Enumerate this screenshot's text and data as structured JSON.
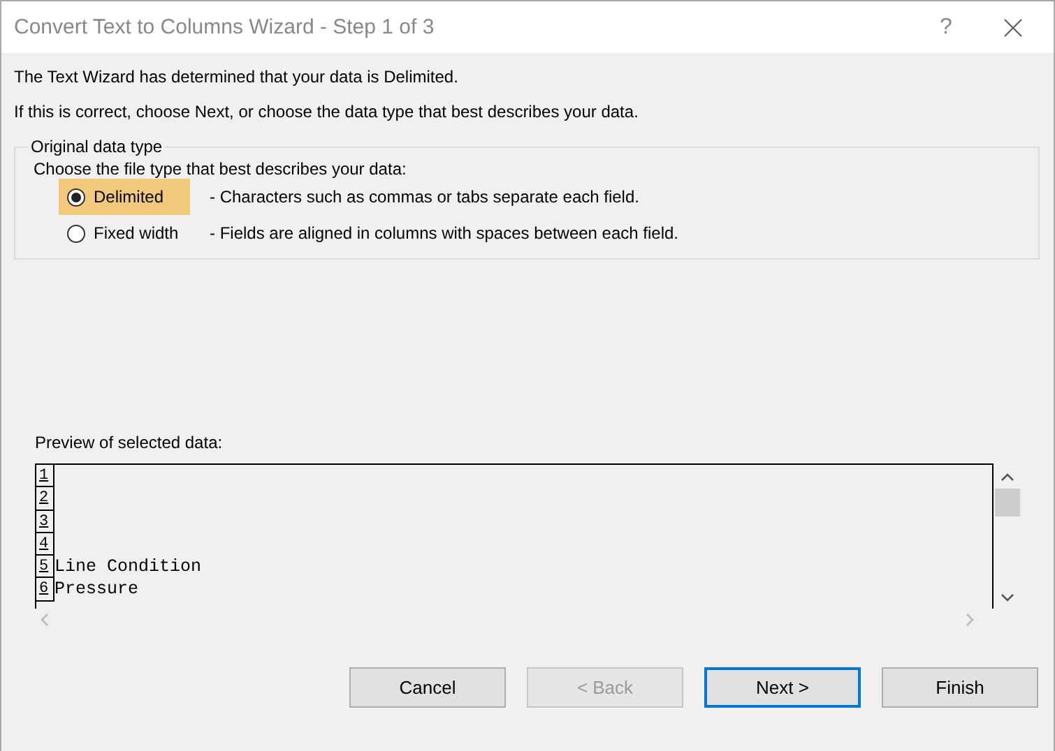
{
  "window": {
    "title": "Convert Text to Columns Wizard - Step 1 of 3",
    "help": "?"
  },
  "intro_lines": [
    "The Text Wizard has determined that your data is Delimited.",
    "If this is correct, choose Next, or choose the data type that best describes your data."
  ],
  "data_type_group": {
    "legend": "Original data type",
    "prompt": "Choose the file type that best describes your data:",
    "options": [
      {
        "label": "Delimited",
        "description": "- Characters such as commas or tabs separate each field.",
        "selected": true
      },
      {
        "label": "Fixed width",
        "description": "- Fields are aligned in columns with spaces between each field.",
        "selected": false
      }
    ]
  },
  "preview": {
    "label": "Preview of selected data:",
    "rows": [
      {
        "number": "1"
      },
      {
        "number": "2"
      },
      {
        "number": "3"
      },
      {
        "number": "4"
      },
      {
        "number": "5",
        "text": "Line Condition"
      },
      {
        "number": "6",
        "text": "Pressure"
      }
    ]
  },
  "buttons": [
    {
      "label": "Cancel",
      "disabled": false,
      "default": false
    },
    {
      "label": "< Back",
      "disabled": true,
      "default": false
    },
    {
      "label": "Next >",
      "disabled": false,
      "default": true
    },
    {
      "label": "Finish",
      "disabled": false,
      "default": false
    }
  ]
}
